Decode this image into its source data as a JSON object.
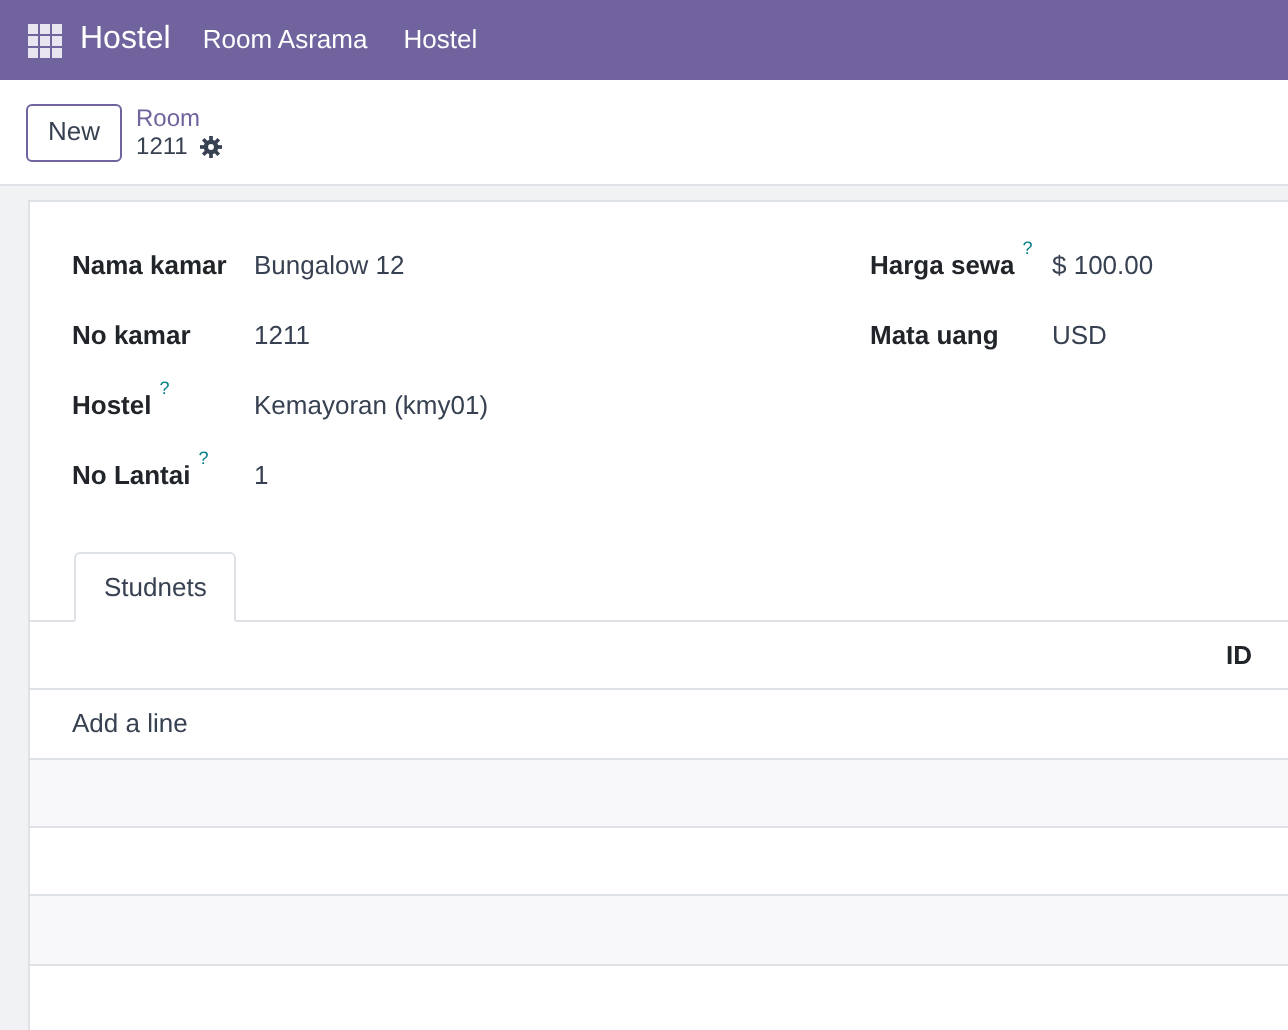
{
  "navbar": {
    "app_name": "Hostel",
    "menu": [
      "Room Asrama",
      "Hostel"
    ]
  },
  "control_panel": {
    "new_button": "New",
    "breadcrumb": "Room",
    "record": "1211"
  },
  "form": {
    "left_fields": [
      {
        "label": "Nama kamar",
        "value": "Bungalow 12"
      },
      {
        "label": "No kamar",
        "value": "1211"
      },
      {
        "label": "Hostel",
        "help": "?",
        "value": "Kemayoran (kmy01)"
      },
      {
        "label": "No Lantai",
        "help": "?",
        "value": "1"
      }
    ],
    "right_fields": [
      {
        "label": "Harga sewa",
        "help": "?",
        "value": "$ 100.00"
      },
      {
        "label": "Mata uang",
        "value": "USD"
      }
    ],
    "tabs": [
      {
        "label": "Studnets",
        "selected": true
      }
    ],
    "table": {
      "columns": [
        "ID"
      ],
      "add_line": "Add a line"
    }
  }
}
